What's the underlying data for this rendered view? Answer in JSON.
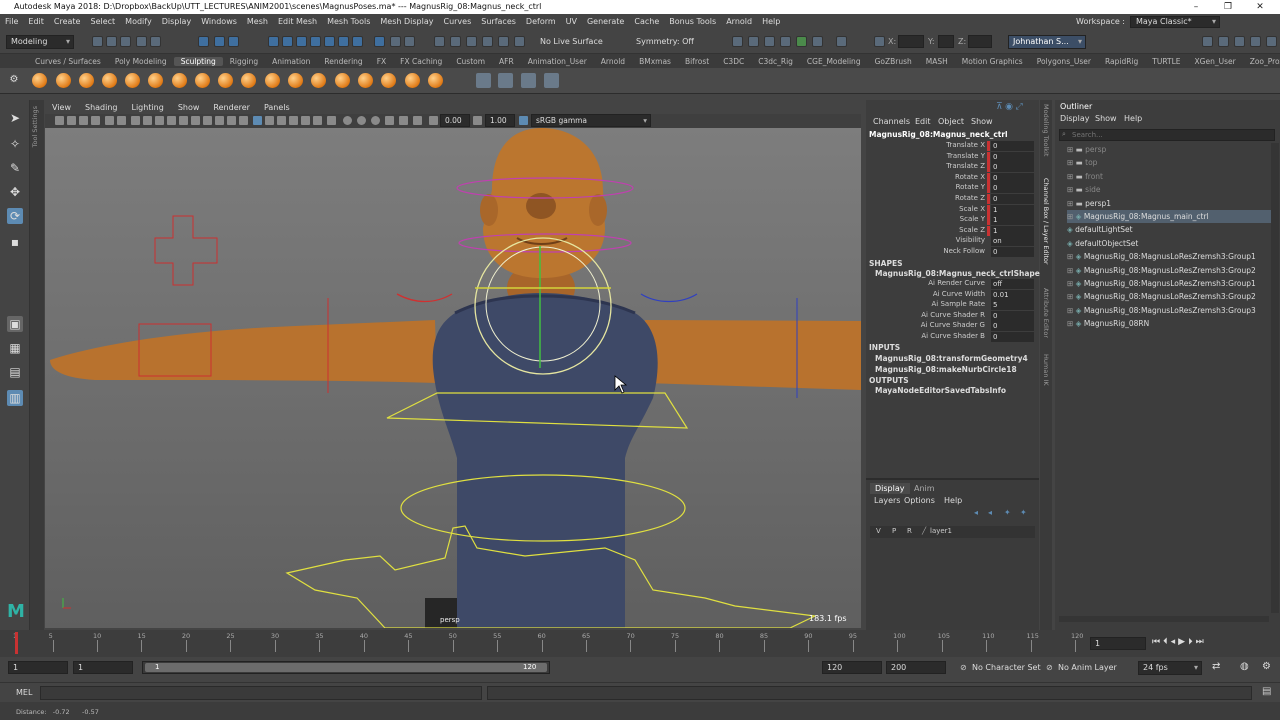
{
  "window": {
    "title": "Autodesk Maya 2018: D:\\Dropbox\\BackUp\\UTT_LECTURES\\ANIM2001\\scenes\\MagnusPoses.ma*  ---  MagnusRig_08:Magnus_neck_ctrl",
    "minimize": "–",
    "maximize": "❐",
    "close": "✕"
  },
  "menubar": [
    "File",
    "Edit",
    "Create",
    "Select",
    "Modify",
    "Display",
    "Windows",
    "Mesh",
    "Edit Mesh",
    "Mesh Tools",
    "Mesh Display",
    "Curves",
    "Surfaces",
    "Deform",
    "UV",
    "Generate",
    "Cache",
    "Bonus Tools",
    "Arnold",
    "Help"
  ],
  "workspace": {
    "label": "Workspace :",
    "value": "Maya Classic*"
  },
  "statusline": {
    "menuset": "Modeling",
    "live_surface": "No Live Surface",
    "symmetry": "Symmetry: Off",
    "x_label": "X:",
    "y_label": "Y:",
    "z_label": "Z:",
    "user": "Johnathan S..."
  },
  "shelf_tabs": [
    "Curves / Surfaces",
    "Poly Modeling",
    "Sculpting",
    "Rigging",
    "Animation",
    "Rendering",
    "FX",
    "FX Caching",
    "Custom",
    "AFR",
    "Animation_User",
    "Arnold",
    "BMxmas",
    "Bifrost",
    "C3DC",
    "C3dc_Rig",
    "CGE_Modeling",
    "GoZBrush",
    "MASH",
    "Motion Graphics",
    "Polygons_User",
    "RapidRig",
    "TURTLE",
    "XGen_User",
    "Zoo_Proxy"
  ],
  "active_shelf_tab": "Sculpting",
  "viewport": {
    "menus": [
      "View",
      "Shading",
      "Lighting",
      "Show",
      "Renderer",
      "Panels"
    ],
    "exposure": "0.00",
    "gamma": "1.00",
    "colorspace": "sRGB gamma",
    "camera": "persp",
    "fps": "183.1 fps"
  },
  "channelbox": {
    "menus": [
      "Channels",
      "Edit",
      "Object",
      "Show"
    ],
    "object": "MagnusRig_08:Magnus_neck_ctrl",
    "attributes": [
      {
        "name": "Translate X",
        "value": "0"
      },
      {
        "name": "Translate Y",
        "value": "0"
      },
      {
        "name": "Translate Z",
        "value": "0"
      },
      {
        "name": "Rotate X",
        "value": "0"
      },
      {
        "name": "Rotate Y",
        "value": "0"
      },
      {
        "name": "Rotate Z",
        "value": "0"
      },
      {
        "name": "Scale X",
        "value": "1"
      },
      {
        "name": "Scale Y",
        "value": "1"
      },
      {
        "name": "Scale Z",
        "value": "1"
      },
      {
        "name": "Visibility",
        "value": "on"
      },
      {
        "name": "Neck Follow",
        "value": "0"
      }
    ],
    "shapes_header": "SHAPES",
    "shape_node": "MagnusRig_08:Magnus_neck_ctrlShape",
    "shape_attributes": [
      {
        "name": "Ai Render Curve",
        "value": "off"
      },
      {
        "name": "Ai Curve Width",
        "value": "0.01"
      },
      {
        "name": "Ai Sample Rate",
        "value": "5"
      },
      {
        "name": "Ai Curve Shader R",
        "value": "0"
      },
      {
        "name": "Ai Curve Shader G",
        "value": "0"
      },
      {
        "name": "Ai Curve Shader B",
        "value": "0"
      }
    ],
    "inputs_header": "INPUTS",
    "inputs": [
      "MagnusRig_08:transformGeometry4",
      "MagnusRig_08:makeNurbCircle18"
    ],
    "outputs_header": "OUTPUTS",
    "outputs": [
      "MayaNodeEditorSavedTabsInfo"
    ]
  },
  "side_tabs": {
    "modeling_toolkit": "Modeling Toolkit",
    "channel_box": "Channel Box / Layer Editor",
    "attribute_editor": "Attribute Editor",
    "tool_settings": "Tool Settings",
    "human_ik": "Human IK"
  },
  "layers": {
    "tabs": [
      "Display",
      "Anim"
    ],
    "menus": [
      "Layers",
      "Options",
      "Help"
    ],
    "row": {
      "v": "V",
      "p": "P",
      "r": "R",
      "name": "layer1"
    }
  },
  "outliner": {
    "title": "Outliner",
    "menus": [
      "Display",
      "Show",
      "Help"
    ],
    "search_placeholder": "Search...",
    "items": [
      {
        "label": "persp",
        "dim": true
      },
      {
        "label": "top",
        "dim": true
      },
      {
        "label": "front",
        "dim": true
      },
      {
        "label": "side",
        "dim": true
      },
      {
        "label": "persp1",
        "dim": false
      },
      {
        "label": "MagnusRig_08:Magnus_main_ctrl",
        "dim": false
      },
      {
        "label": "defaultLightSet",
        "dim": false
      },
      {
        "label": "defaultObjectSet",
        "dim": false
      },
      {
        "label": "MagnusRig_08:MagnusLoResZremsh3:Group1",
        "dim": false
      },
      {
        "label": "MagnusRig_08:MagnusLoResZremsh3:Group2",
        "dim": false
      },
      {
        "label": "MagnusRig_08:MagnusLoResZremsh3:Group1",
        "dim": false
      },
      {
        "label": "MagnusRig_08:MagnusLoResZremsh3:Group2",
        "dim": false
      },
      {
        "label": "MagnusRig_08:MagnusLoResZremsh3:Group3",
        "dim": false
      },
      {
        "label": "MagnusRig_08RN",
        "dim": false
      }
    ]
  },
  "timeline": {
    "ticks": [
      "1",
      "5",
      "10",
      "15",
      "20",
      "25",
      "30",
      "35",
      "40",
      "45",
      "50",
      "55",
      "60",
      "65",
      "70",
      "75",
      "80",
      "85",
      "90",
      "95",
      "100",
      "105",
      "110",
      "115",
      "120"
    ],
    "current_frame": "1"
  },
  "range": {
    "start": "1",
    "start_inner": "1",
    "slider_start": "1",
    "slider_end": "120",
    "end_inner": "120",
    "end": "200",
    "character_set": "No Character Set",
    "anim_layer": "No Anim Layer",
    "fps": "24 fps"
  },
  "cmdline": {
    "label": "MEL"
  },
  "helpline": {
    "text": "Distance:   -0.72      -0.57"
  }
}
